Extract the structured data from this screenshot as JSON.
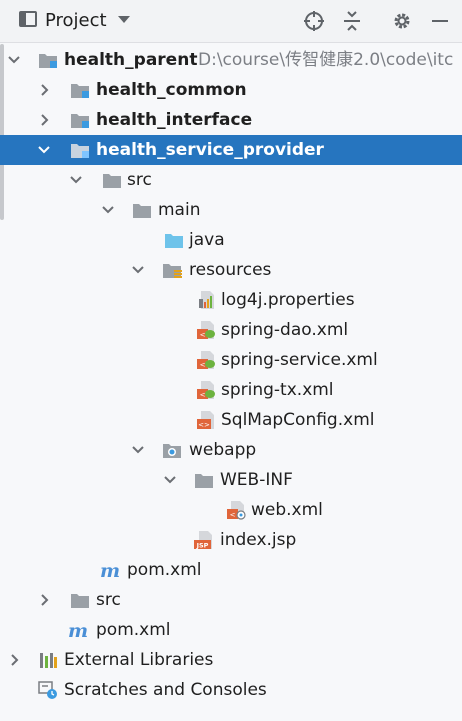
{
  "header": {
    "title": "Project",
    "toggle_icon": "project-panel-icon",
    "dropdown_icon": "chevron-down-icon",
    "actions": [
      "locate-icon",
      "collapse-all-icon",
      "gear-icon",
      "minimize-icon"
    ]
  },
  "tree": {
    "health_parent": {
      "label": "health_parent",
      "path": "D:\\course\\传智健康2.0\\code\\itc"
    },
    "health_common": {
      "label": "health_common"
    },
    "health_interface": {
      "label": "health_interface"
    },
    "health_service_provider": {
      "label": "health_service_provider",
      "src": {
        "label": "src"
      },
      "main": {
        "label": "main"
      },
      "java": {
        "label": "java"
      },
      "resources": {
        "label": "resources"
      },
      "log4j": {
        "label": "log4j.properties"
      },
      "spring_dao": {
        "label": "spring-dao.xml"
      },
      "spring_service": {
        "label": "spring-service.xml"
      },
      "spring_tx": {
        "label": "spring-tx.xml"
      },
      "sqlmap": {
        "label": "SqlMapConfig.xml"
      },
      "webapp": {
        "label": "webapp"
      },
      "web_inf": {
        "label": "WEB-INF"
      },
      "web_xml": {
        "label": "web.xml"
      },
      "index_jsp": {
        "label": "index.jsp"
      },
      "pom": {
        "label": "pom.xml"
      }
    },
    "root_src": {
      "label": "src"
    },
    "root_pom": {
      "label": "pom.xml"
    },
    "external_libraries": {
      "label": "External Libraries"
    },
    "scratches": {
      "label": "Scratches and Consoles"
    }
  },
  "colors": {
    "selection": "#2675bf",
    "folder": "#9aa0a6",
    "source_folder": "#6ec3ea",
    "module_marker": "#3b9ae0",
    "maven": "#4a8fd6",
    "xml_badge": "#e0653a",
    "spring_leaf": "#6db33f"
  }
}
